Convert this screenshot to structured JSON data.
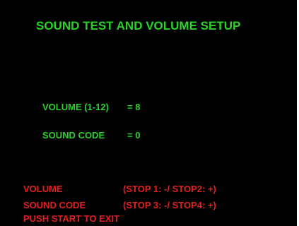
{
  "title": "SOUND TEST AND VOLUME SETUP",
  "settings": {
    "volume": {
      "label": "VOLUME (1-12)",
      "value": "=  8"
    },
    "sound_code": {
      "label": "SOUND CODE",
      "value": "=  0"
    }
  },
  "help": [
    {
      "item": "VOLUME",
      "controls": "(STOP 1: -/ STOP2: +)"
    },
    {
      "item": "SOUND CODE",
      "controls": "(STOP 3: -/ STOP4: +)"
    },
    {
      "item": "PUSH START TO EXIT",
      "controls": ""
    }
  ],
  "colors": {
    "background": "#000000",
    "primary_text": "#2bd22b",
    "help_text": "#e12020"
  }
}
